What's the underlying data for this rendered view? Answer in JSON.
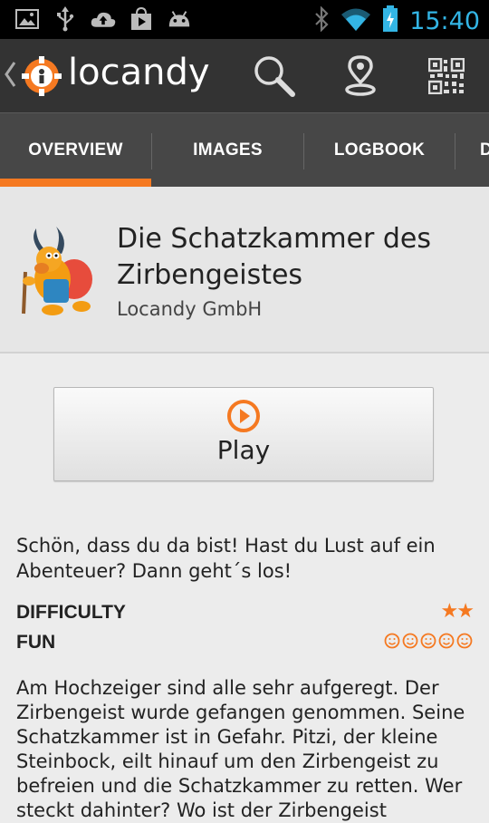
{
  "status_bar": {
    "time": "15:40",
    "left_icons": [
      "image-icon",
      "usb-icon",
      "cloud-upload-icon",
      "play-store-icon",
      "android-icon"
    ],
    "right_icons": [
      "bluetooth-icon",
      "wifi-icon",
      "battery-icon"
    ],
    "accent_color": "#33b5e5"
  },
  "action_bar": {
    "app_name": "locandy",
    "actions": [
      "search-icon",
      "location-pin-icon",
      "qr-code-icon"
    ],
    "brand_color": "#f57921"
  },
  "tabs": [
    {
      "label": "OVERVIEW",
      "active": true
    },
    {
      "label": "IMAGES",
      "active": false
    },
    {
      "label": "LOGBOOK",
      "active": false
    },
    {
      "label": "D",
      "active": false
    }
  ],
  "header": {
    "title": "Die Schatzkammer des Zirbengeistes",
    "publisher": "Locandy GmbH"
  },
  "play_button": {
    "label": "Play"
  },
  "intro": "Schön, dass du da bist! Hast du Lust auf ein Abenteuer? Dann geht´s los!",
  "ratings": [
    {
      "label": "DIFFICULTY",
      "kind": "stars",
      "value": 2,
      "symbols": "★★"
    },
    {
      "label": "FUN",
      "kind": "smileys",
      "value": 5,
      "max": 5
    }
  ],
  "description": "Am Hochzeiger sind alle sehr aufgeregt. Der Zirbengeist wurde gefangen genommen. Seine Schatzkammer ist in Gefahr. Pitzi, der kleine Steinbock, eilt hinauf um den Zirbengeist zu befreien und die Schatzkammer zu retten. Wer steckt dahinter? Wo ist der Zirbengeist"
}
